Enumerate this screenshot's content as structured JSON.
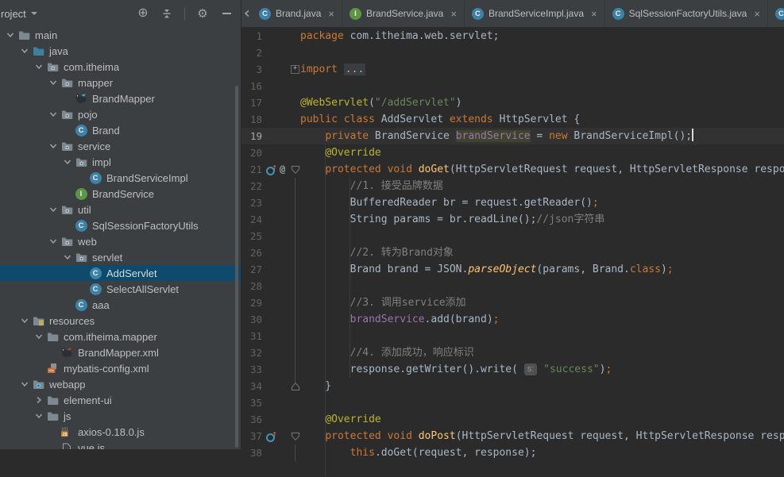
{
  "palette": {
    "editor_bg": "#2b2b2b",
    "panel_bg": "#3c3f41",
    "selection_blue": "#0d4a6b",
    "keyword": "#cc7832",
    "string": "#6a8759",
    "comment": "#808080",
    "annotation": "#bbb529",
    "method": "#ffc66d",
    "field": "#9876aa",
    "default_text": "#a9b7c6",
    "line_number": "#606366",
    "class_icon": "#3c82a8",
    "interface_icon": "#5c9643",
    "folder": "#7d8890",
    "source_folder": "#3d7f9c"
  },
  "project_panel": {
    "title": "roject",
    "toolbar_icons": [
      "locate-icon",
      "collapse-all-icon",
      "divider",
      "settings-gear-icon",
      "hide-panel-icon"
    ],
    "tree": [
      {
        "label": "main",
        "icon": "folder",
        "level": 1,
        "chevron": "expanded"
      },
      {
        "label": "java",
        "icon": "folder-source",
        "level": 2,
        "chevron": "expanded"
      },
      {
        "label": "com.itheima",
        "icon": "package",
        "level": 3,
        "chevron": "expanded"
      },
      {
        "label": "mapper",
        "icon": "package",
        "level": 4,
        "chevron": "expanded"
      },
      {
        "label": "BrandMapper",
        "icon": "mybatis-java",
        "level": 5,
        "chevron": "none"
      },
      {
        "label": "pojo",
        "icon": "package",
        "level": 4,
        "chevron": "expanded"
      },
      {
        "label": "Brand",
        "icon": "class",
        "level": 5,
        "chevron": "none"
      },
      {
        "label": "service",
        "icon": "package",
        "level": 4,
        "chevron": "expanded"
      },
      {
        "label": "impl",
        "icon": "package",
        "level": 5,
        "chevron": "expanded"
      },
      {
        "label": "BrandServiceImpl",
        "icon": "class",
        "level": 6,
        "chevron": "none"
      },
      {
        "label": "BrandService",
        "icon": "interface",
        "level": 5,
        "chevron": "none"
      },
      {
        "label": "util",
        "icon": "package",
        "level": 4,
        "chevron": "expanded"
      },
      {
        "label": "SqlSessionFactoryUtils",
        "icon": "class",
        "level": 5,
        "chevron": "none"
      },
      {
        "label": "web",
        "icon": "package",
        "level": 4,
        "chevron": "expanded"
      },
      {
        "label": "servlet",
        "icon": "package",
        "level": 5,
        "chevron": "expanded"
      },
      {
        "label": "AddServlet",
        "icon": "class",
        "level": 6,
        "chevron": "none",
        "selected": true
      },
      {
        "label": "SelectAllServlet",
        "icon": "class",
        "level": 6,
        "chevron": "none"
      },
      {
        "label": "aaa",
        "icon": "class",
        "level": 5,
        "chevron": "none"
      },
      {
        "label": "resources",
        "icon": "folder-resources",
        "level": 2,
        "chevron": "expanded"
      },
      {
        "label": "com.itheima.mapper",
        "icon": "folder",
        "level": 3,
        "chevron": "expanded"
      },
      {
        "label": "BrandMapper.xml",
        "icon": "mybatis-xml",
        "level": 4,
        "chevron": "none"
      },
      {
        "label": "mybatis-config.xml",
        "icon": "xml-file",
        "level": 3,
        "chevron": "none"
      },
      {
        "label": "webapp",
        "icon": "folder-web",
        "level": 2,
        "chevron": "expanded"
      },
      {
        "label": "element-ui",
        "icon": "folder",
        "level": 3,
        "chevron": "collapsed"
      },
      {
        "label": "js",
        "icon": "folder",
        "level": 3,
        "chevron": "expanded"
      },
      {
        "label": "axios-0.18.0.js",
        "icon": "js-file",
        "level": 4,
        "chevron": "none"
      },
      {
        "label": "vue.js",
        "icon": "file",
        "level": 4,
        "chevron": "none"
      }
    ]
  },
  "tab_bar": {
    "close_glyph": "×",
    "tabs": [
      {
        "label": "Brand.java",
        "icon": "class"
      },
      {
        "label": "BrandService.java",
        "icon": "interface"
      },
      {
        "label": "BrandServiceImpl.java",
        "icon": "class"
      },
      {
        "label": "SqlSessionFactoryUtils.java",
        "icon": "class"
      },
      {
        "label": "",
        "icon": "class"
      }
    ]
  },
  "editor": {
    "caret_line": "19",
    "lines": [
      {
        "num": "1",
        "seg": [
          [
            "k",
            "package"
          ],
          [
            "d",
            " com.itheima.web.servlet;"
          ]
        ]
      },
      {
        "num": "2",
        "seg": []
      },
      {
        "num": "3",
        "fold": "plus",
        "seg": [
          [
            "k",
            "import"
          ],
          [
            "d",
            " "
          ],
          [
            "fold",
            "..."
          ]
        ]
      },
      {
        "num": "16",
        "seg": []
      },
      {
        "num": "17",
        "seg": [
          [
            "a",
            "@WebServlet"
          ],
          [
            "d",
            "("
          ],
          [
            "s",
            "\"/addServlet\""
          ],
          [
            "d",
            ")"
          ]
        ]
      },
      {
        "num": "18",
        "seg": [
          [
            "k",
            "public class"
          ],
          [
            "d",
            " AddServlet "
          ],
          [
            "k",
            "extends"
          ],
          [
            "d",
            " HttpServlet {"
          ]
        ]
      },
      {
        "num": "19",
        "current": true,
        "caret": true,
        "seg": [
          [
            "d",
            "    "
          ],
          [
            "k",
            "private"
          ],
          [
            "d",
            " BrandService "
          ],
          [
            "hl",
            "brandService"
          ],
          [
            "d",
            " = "
          ],
          [
            "k",
            "new"
          ],
          [
            "d",
            " BrandServiceImpl();"
          ]
        ]
      },
      {
        "num": "20",
        "seg": [
          [
            "d",
            "    "
          ],
          [
            "a",
            "@Override"
          ]
        ]
      },
      {
        "num": "21",
        "gutter": "override-at",
        "fold": "down",
        "seg": [
          [
            "d",
            "    "
          ],
          [
            "k",
            "protected"
          ],
          [
            "d",
            " "
          ],
          [
            "k",
            "void"
          ],
          [
            "d",
            " "
          ],
          [
            "m",
            "doGet"
          ],
          [
            "d",
            "(HttpServletRequest request, HttpServletResponse response) {"
          ]
        ]
      },
      {
        "num": "22",
        "seg": [
          [
            "d",
            "        "
          ],
          [
            "c",
            "//1. 接受品牌数据"
          ]
        ]
      },
      {
        "num": "23",
        "seg": [
          [
            "d",
            "        BufferedReader br = request.getReader()"
          ],
          [
            "k",
            ";"
          ]
        ]
      },
      {
        "num": "24",
        "seg": [
          [
            "d",
            "        String params = br.readLine();"
          ],
          [
            "c",
            "//json字符串"
          ]
        ]
      },
      {
        "num": "25",
        "seg": []
      },
      {
        "num": "26",
        "seg": [
          [
            "d",
            "        "
          ],
          [
            "c",
            "//2. 转为Brand对象"
          ]
        ]
      },
      {
        "num": "27",
        "seg": [
          [
            "d",
            "        Brand brand = JSON."
          ],
          [
            "ms",
            "parseObject"
          ],
          [
            "d",
            "(params, Brand."
          ],
          [
            "k",
            "class"
          ],
          [
            "d",
            ")"
          ],
          [
            "k",
            ";"
          ]
        ]
      },
      {
        "num": "28",
        "seg": []
      },
      {
        "num": "29",
        "seg": [
          [
            "d",
            "        "
          ],
          [
            "c",
            "//3. 调用service添加"
          ]
        ]
      },
      {
        "num": "30",
        "seg": [
          [
            "d",
            "        "
          ],
          [
            "f",
            "brandService"
          ],
          [
            "d",
            ".add(brand)"
          ],
          [
            "k",
            ";"
          ]
        ]
      },
      {
        "num": "31",
        "seg": []
      },
      {
        "num": "32",
        "seg": [
          [
            "d",
            "        "
          ],
          [
            "c",
            "//4. 添加成功，响应标识"
          ]
        ]
      },
      {
        "num": "33",
        "seg": [
          [
            "d",
            "        response.getWriter().write( "
          ],
          [
            "hint",
            "s:"
          ],
          [
            "d",
            " "
          ],
          [
            "s",
            "\"success\""
          ],
          [
            "d",
            ")"
          ],
          [
            "k",
            ";"
          ]
        ]
      },
      {
        "num": "34",
        "fold": "up",
        "seg": [
          [
            "d",
            "    }"
          ]
        ]
      },
      {
        "num": "35",
        "seg": []
      },
      {
        "num": "36",
        "seg": [
          [
            "d",
            "    "
          ],
          [
            "a",
            "@Override"
          ]
        ]
      },
      {
        "num": "37",
        "gutter": "override",
        "fold": "down",
        "seg": [
          [
            "d",
            "    "
          ],
          [
            "k",
            "protected"
          ],
          [
            "d",
            " "
          ],
          [
            "k",
            "void"
          ],
          [
            "d",
            " "
          ],
          [
            "m",
            "doPost"
          ],
          [
            "d",
            "(HttpServletRequest request, HttpServletResponse response) {"
          ]
        ]
      },
      {
        "num": "38",
        "seg": [
          [
            "d",
            "        "
          ],
          [
            "k",
            "this"
          ],
          [
            "d",
            ".doGet(request, response);"
          ]
        ]
      }
    ]
  }
}
